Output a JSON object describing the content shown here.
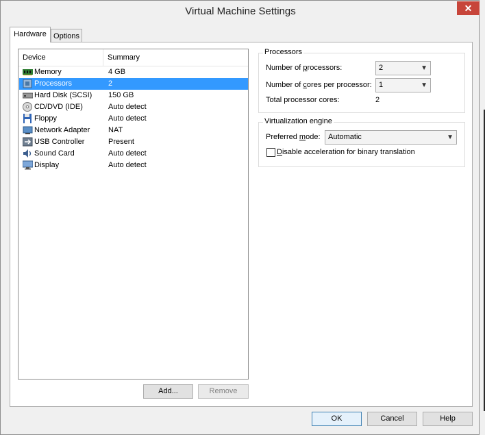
{
  "window": {
    "title": "Virtual Machine Settings",
    "close_label": "✕"
  },
  "tabs": [
    {
      "label": "Hardware",
      "active": true
    },
    {
      "label": "Options",
      "active": false
    }
  ],
  "device_list": {
    "headers": {
      "device": "Device",
      "summary": "Summary"
    },
    "rows": [
      {
        "device": "Memory",
        "summary": "4 GB",
        "icon": "memory-icon"
      },
      {
        "device": "Processors",
        "summary": "2",
        "icon": "processor-icon",
        "selected": true
      },
      {
        "device": "Hard Disk (SCSI)",
        "summary": "150 GB",
        "icon": "hard-disk-icon"
      },
      {
        "device": "CD/DVD (IDE)",
        "summary": "Auto detect",
        "icon": "cd-dvd-icon"
      },
      {
        "device": "Floppy",
        "summary": "Auto detect",
        "icon": "floppy-icon"
      },
      {
        "device": "Network Adapter",
        "summary": "NAT",
        "icon": "network-adapter-icon"
      },
      {
        "device": "USB Controller",
        "summary": "Present",
        "icon": "usb-icon"
      },
      {
        "device": "Sound Card",
        "summary": "Auto detect",
        "icon": "sound-card-icon"
      },
      {
        "device": "Display",
        "summary": "Auto detect",
        "icon": "display-icon"
      }
    ],
    "add_label": "Add...",
    "remove_label": "Remove"
  },
  "processors": {
    "group_title": "Processors",
    "num_processors_label_pre": "Number of ",
    "num_processors_label_mn": "p",
    "num_processors_label_post": "rocessors:",
    "num_processors_value": "2",
    "cores_label_pre": "Number of ",
    "cores_label_mn": "c",
    "cores_label_post": "ores per processor:",
    "cores_value": "1",
    "total_label": "Total processor cores:",
    "total_value": "2"
  },
  "virtualization": {
    "group_title": "Virtualization engine",
    "mode_label_pre": "Preferred ",
    "mode_label_mn": "m",
    "mode_label_post": "ode:",
    "mode_value": "Automatic",
    "disable_accel_mn": "D",
    "disable_accel_post": "isable acceleration for binary translation",
    "disable_accel_checked": false
  },
  "footer": {
    "ok_label": "OK",
    "cancel_label": "Cancel",
    "help_label": "Help"
  }
}
